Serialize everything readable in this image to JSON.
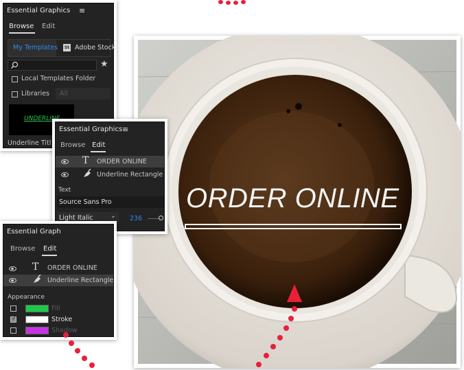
{
  "colors": {
    "accent": "#2d8ceb",
    "arrow": "#e8203a",
    "fill_swatch": "#1ec84a",
    "stroke_swatch": "#ffffff",
    "shadow_swatch": "#c832e6"
  },
  "panel1": {
    "title": "Essential Graphics",
    "menu_icon": "≡",
    "tabs": {
      "browse": "Browse",
      "edit": "Edit"
    },
    "my_templates": "My Templates",
    "stock_badge": "St",
    "adobe_stock": "Adobe Stock",
    "search_icon": "search-icon",
    "star_icon": "★",
    "local_templates": "Local Templates Folder",
    "libraries": "Libraries",
    "libraries_select": "All",
    "thumb_text": "UNDERLINE",
    "thumb_caption": "Underline Titl"
  },
  "panel2": {
    "title": "Essential Graphics",
    "menu_icon": "≡",
    "tabs": {
      "browse": "Browse",
      "edit": "Edit"
    },
    "layers": [
      {
        "icon": "T",
        "name": "ORDER ONLINE"
      },
      {
        "icon": "pen",
        "name": "Underline Rectangle"
      }
    ],
    "text_section": "Text",
    "font_name": "Source Sans Pro",
    "font_style": "Light Italic",
    "font_size": "236"
  },
  "panel3": {
    "title": "Essential Graph",
    "tabs": {
      "browse": "Browse",
      "edit": "Edit"
    },
    "layers": [
      {
        "icon": "T",
        "name": "ORDER ONLINE"
      },
      {
        "icon": "pen",
        "name": "Underline Rectangle"
      }
    ],
    "appearance": "Appearance",
    "fill": "Fill",
    "stroke": "Stroke",
    "shadow": "Shadow"
  },
  "preview": {
    "title_text": "ORDER ONLINE"
  }
}
